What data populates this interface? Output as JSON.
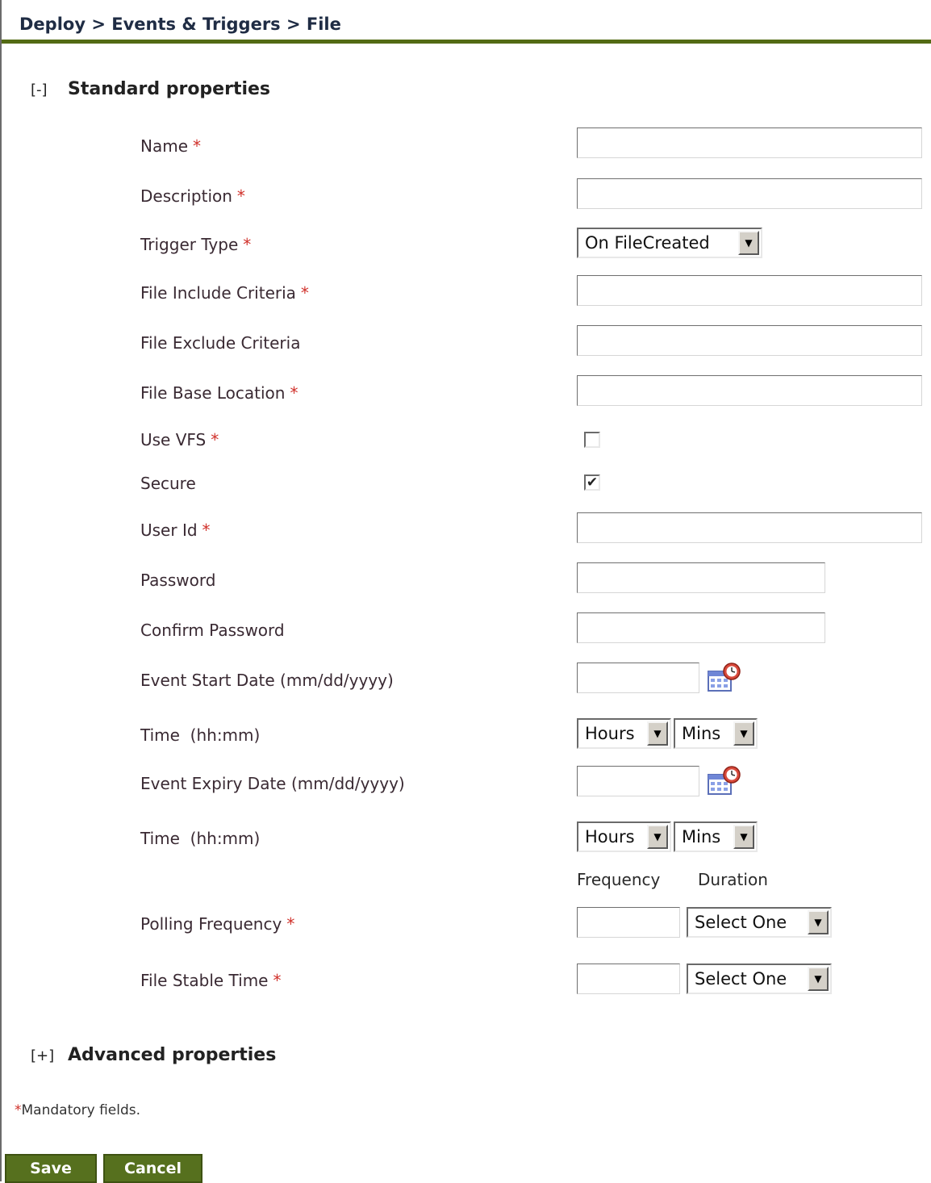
{
  "breadcrumb": "Deploy > Events & Triggers > File",
  "sections": {
    "standard": {
      "toggle": "[-]",
      "title": "Standard properties"
    },
    "advanced": {
      "toggle": "[+]",
      "title": "Advanced properties"
    }
  },
  "required_mark": "*",
  "fields": {
    "name": "Name",
    "description": "Description",
    "trigger_type": "Trigger Type",
    "include": "File Include Criteria",
    "exclude": "File Exclude Criteria",
    "base_location": "File Base Location",
    "use_vfs": "Use VFS",
    "secure": "Secure",
    "user_id": "User Id",
    "password": "Password",
    "confirm_password": "Confirm Password",
    "start_date": "Event Start Date (mm/dd/yyyy)",
    "start_time": "Time  (hh:mm)",
    "expiry_date": "Event Expiry Date (mm/dd/yyyy)",
    "expiry_time": "Time  (hh:mm)",
    "polling": "Polling Frequency",
    "stable": "File Stable Time"
  },
  "values": {
    "trigger_type": "On FileCreated",
    "hours": "Hours",
    "mins": "Mins",
    "select_one": "Select One",
    "use_vfs_checked": false,
    "secure_checked": true
  },
  "columns": {
    "frequency": "Frequency",
    "duration": "Duration"
  },
  "footer": {
    "mandatory_note": "Mandatory fields."
  },
  "buttons": {
    "save": "Save",
    "cancel": "Cancel"
  },
  "colors": {
    "accent": "#56701e",
    "required": "#d0302a",
    "header_rule": "#536b14"
  }
}
